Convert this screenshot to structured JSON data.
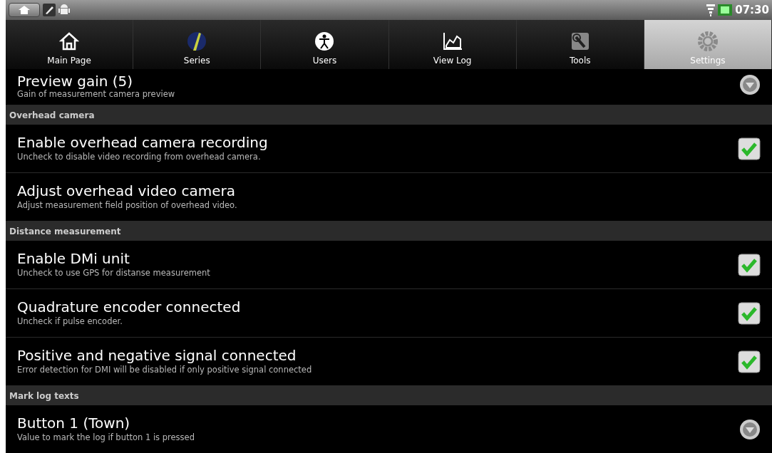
{
  "status_bar": {
    "time": "07:30"
  },
  "tabs": [
    {
      "label": "Main Page",
      "selected": false
    },
    {
      "label": "Series",
      "selected": false
    },
    {
      "label": "Users",
      "selected": false
    },
    {
      "label": "View Log",
      "selected": false
    },
    {
      "label": "Tools",
      "selected": false
    },
    {
      "label": "Settings",
      "selected": true
    }
  ],
  "settings": [
    {
      "kind": "dropdown",
      "title": "Preview gain (5)",
      "summary": "Gain of measurement camera preview"
    },
    {
      "kind": "header",
      "title": "Overhead camera"
    },
    {
      "kind": "checkbox",
      "title": "Enable overhead camera recording",
      "summary": "Uncheck to disable video recording from overhead camera.",
      "checked": true
    },
    {
      "kind": "plain",
      "title": "Adjust overhead video camera",
      "summary": "Adjust measurement field position of overhead video."
    },
    {
      "kind": "header",
      "title": "Distance measurement"
    },
    {
      "kind": "checkbox",
      "title": "Enable DMi unit",
      "summary": "Uncheck to use GPS for distanse measurement",
      "checked": true
    },
    {
      "kind": "checkbox",
      "title": "Quadrature encoder connected",
      "summary": "Uncheck if pulse encoder.",
      "checked": true
    },
    {
      "kind": "checkbox",
      "title": "Positive and negative signal connected",
      "summary": "Error detection for DMI will be disabled if only positive signal connected",
      "checked": true
    },
    {
      "kind": "header",
      "title": "Mark log texts"
    },
    {
      "kind": "dropdown",
      "title": "Button 1 (Town)",
      "summary": "Value to mark the log if button 1 is pressed"
    }
  ]
}
